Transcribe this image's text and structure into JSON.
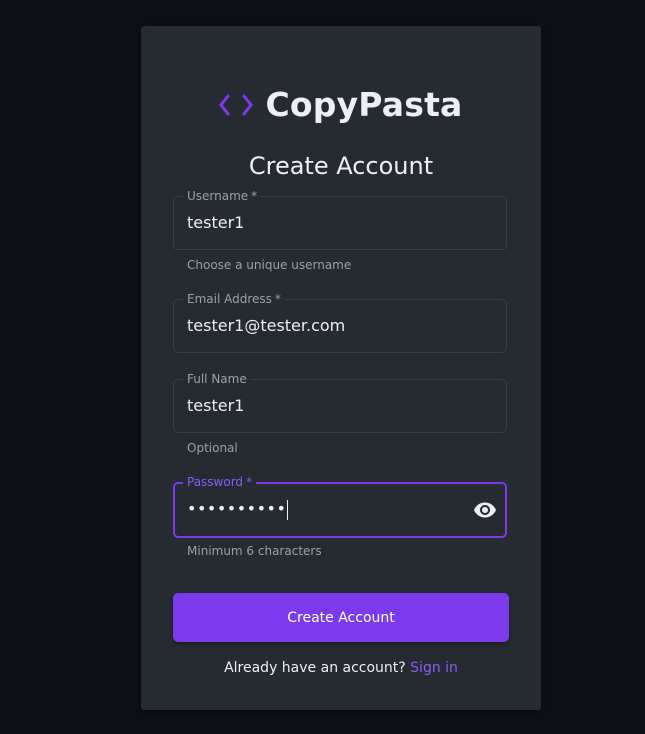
{
  "brand": {
    "name": "CopyPasta",
    "icon": "code-brackets-icon",
    "accent_color": "#7c3aed"
  },
  "form": {
    "title": "Create Account",
    "fields": {
      "username": {
        "label": "Username",
        "required_mark": "*",
        "value": "tester1",
        "helper": "Choose a unique username"
      },
      "email": {
        "label": "Email Address",
        "required_mark": "*",
        "value": "tester1@tester.com"
      },
      "full_name": {
        "label": "Full Name",
        "value": "tester1",
        "helper": "Optional"
      },
      "password": {
        "label": "Password",
        "required_mark": "*",
        "masked_value": "••••••••••",
        "helper": "Minimum 6 characters",
        "visibility_icon": "eye-icon"
      }
    },
    "submit_label": "Create Account",
    "signin_prompt": "Already have an account?",
    "signin_link": "Sign in"
  }
}
